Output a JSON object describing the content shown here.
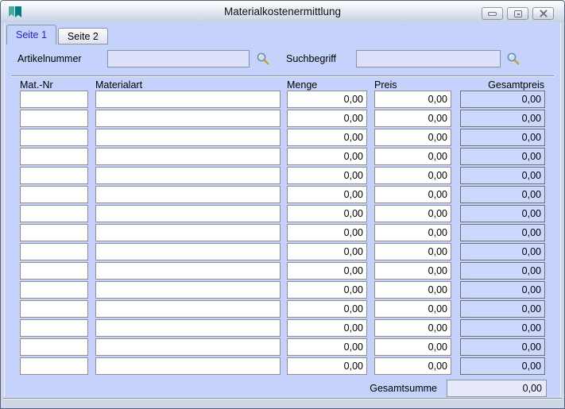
{
  "window": {
    "title": "Materialkostenermittlung"
  },
  "icons": {
    "app": "bookmarks-icon",
    "minimize": "minimize-icon",
    "maximize": "maximize-icon",
    "close": "close-icon",
    "search": "magnifier-icon"
  },
  "tabs": [
    {
      "label": "Seite 1",
      "active": true
    },
    {
      "label": "Seite 2",
      "active": false
    }
  ],
  "search": {
    "artikelnummer_label": "Artikelnummer",
    "artikelnummer_value": "",
    "suchbegriff_label": "Suchbegriff",
    "suchbegriff_value": ""
  },
  "table": {
    "headers": [
      "Mat.-Nr",
      "Materialart",
      "Menge",
      "Preis",
      "Gesamtpreis"
    ],
    "rows": [
      {
        "mat_nr": "",
        "materialart": "",
        "menge": "0,00",
        "preis": "0,00",
        "gesamtpreis": "0,00"
      },
      {
        "mat_nr": "",
        "materialart": "",
        "menge": "0,00",
        "preis": "0,00",
        "gesamtpreis": "0,00"
      },
      {
        "mat_nr": "",
        "materialart": "",
        "menge": "0,00",
        "preis": "0,00",
        "gesamtpreis": "0,00"
      },
      {
        "mat_nr": "",
        "materialart": "",
        "menge": "0,00",
        "preis": "0,00",
        "gesamtpreis": "0,00"
      },
      {
        "mat_nr": "",
        "materialart": "",
        "menge": "0,00",
        "preis": "0,00",
        "gesamtpreis": "0,00"
      },
      {
        "mat_nr": "",
        "materialart": "",
        "menge": "0,00",
        "preis": "0,00",
        "gesamtpreis": "0,00"
      },
      {
        "mat_nr": "",
        "materialart": "",
        "menge": "0,00",
        "preis": "0,00",
        "gesamtpreis": "0,00"
      },
      {
        "mat_nr": "",
        "materialart": "",
        "menge": "0,00",
        "preis": "0,00",
        "gesamtpreis": "0,00"
      },
      {
        "mat_nr": "",
        "materialart": "",
        "menge": "0,00",
        "preis": "0,00",
        "gesamtpreis": "0,00"
      },
      {
        "mat_nr": "",
        "materialart": "",
        "menge": "0,00",
        "preis": "0,00",
        "gesamtpreis": "0,00"
      },
      {
        "mat_nr": "",
        "materialart": "",
        "menge": "0,00",
        "preis": "0,00",
        "gesamtpreis": "0,00"
      },
      {
        "mat_nr": "",
        "materialart": "",
        "menge": "0,00",
        "preis": "0,00",
        "gesamtpreis": "0,00"
      },
      {
        "mat_nr": "",
        "materialart": "",
        "menge": "0,00",
        "preis": "0,00",
        "gesamtpreis": "0,00"
      },
      {
        "mat_nr": "",
        "materialart": "",
        "menge": "0,00",
        "preis": "0,00",
        "gesamtpreis": "0,00"
      },
      {
        "mat_nr": "",
        "materialart": "",
        "menge": "0,00",
        "preis": "0,00",
        "gesamtpreis": "0,00"
      }
    ]
  },
  "footer": {
    "gesamtsumme_label": "Gesamtsumme",
    "gesamtsumme_value": "0,00"
  },
  "colors": {
    "client_bg": "#c4d2fc",
    "field_lavender": "#dde0fb",
    "readonly_cell_bg": "#ccd8fd",
    "total_field_bg": "#e7eafd",
    "accent_teal_dark": "#00807f",
    "accent_teal_light": "#4aa9a2",
    "active_tab_text": "#2525cd"
  }
}
